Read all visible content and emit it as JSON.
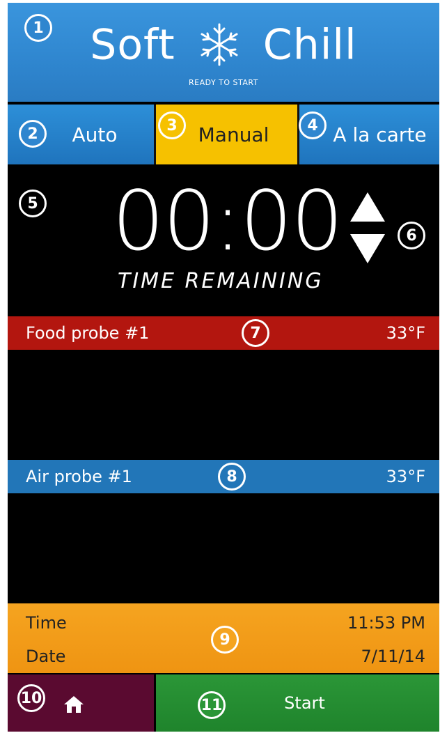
{
  "header": {
    "title_left": "Soft",
    "title_right": "Chill",
    "icon": "snowflake-icon",
    "status": "READY TO START"
  },
  "modes": [
    {
      "label": "Auto",
      "selected": false
    },
    {
      "label": "Manual",
      "selected": true
    },
    {
      "label": "A la carte",
      "selected": false
    }
  ],
  "timer": {
    "value": "00:00",
    "label": "TIME REMAINING",
    "up_icon": "arrow-up-icon",
    "down_icon": "arrow-down-icon"
  },
  "probes": {
    "food": {
      "name": "Food probe #1",
      "temp": "33°F"
    },
    "air": {
      "name": "Air probe #1",
      "temp": "33°F"
    }
  },
  "datetime": {
    "time_label": "Time",
    "time_value": "11:53 PM",
    "date_label": "Date",
    "date_value": "7/11/14"
  },
  "bottom": {
    "home_icon": "home-icon",
    "start_label": "Start"
  },
  "callouts": [
    "1",
    "2",
    "3",
    "4",
    "5",
    "6",
    "7",
    "8",
    "9",
    "10",
    "11"
  ],
  "colors": {
    "header": "#2f86cf",
    "manual": "#f6c100",
    "food_probe": "#b3160f",
    "air_probe": "#2276b8",
    "datetime": "#f5a420",
    "home": "#5a0a30",
    "start": "#2b9637"
  }
}
